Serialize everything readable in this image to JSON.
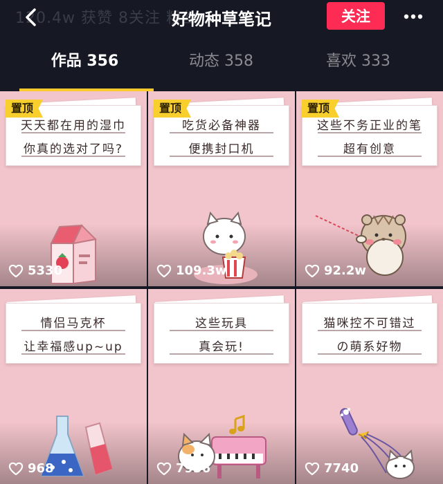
{
  "header": {
    "bg_stats": "120.4w 获赞   8关注   粉丝",
    "title": "好物种草笔记",
    "follow_label": "关注"
  },
  "tabs": [
    {
      "label": "作品 356"
    },
    {
      "label": "动态 358"
    },
    {
      "label": "喜欢 333"
    }
  ],
  "posts": [
    {
      "pinned": "置顶",
      "line1": "天天都在用的湿巾",
      "line2": "你真的选对了吗?",
      "likes": "5330"
    },
    {
      "pinned": "置顶",
      "line1": "吃货必备神器",
      "line2": "便携封口机",
      "likes": "109.3w"
    },
    {
      "pinned": "置顶",
      "line1": "这些不务正业的笔",
      "line2": "超有创意",
      "likes": "92.2w"
    },
    {
      "line1": "情侣马克杯",
      "line2": "让幸福感up~up",
      "likes": "968"
    },
    {
      "line1": "这些玩具",
      "line2": "真会玩!",
      "likes": "7936"
    },
    {
      "line1": "猫咪控不可错过",
      "line2": "の萌系好物",
      "likes": "7740"
    }
  ],
  "colors": {
    "background": "#161823",
    "accent_red": "#fe2c55",
    "tab_indicator": "#fecb2e",
    "card_pink": "#f2c4cb",
    "pin_yellow": "#f8cf2d"
  },
  "icons": {
    "back": "chevron-left-icon",
    "more": "more-dots-icon",
    "like": "heart-outline-icon"
  }
}
